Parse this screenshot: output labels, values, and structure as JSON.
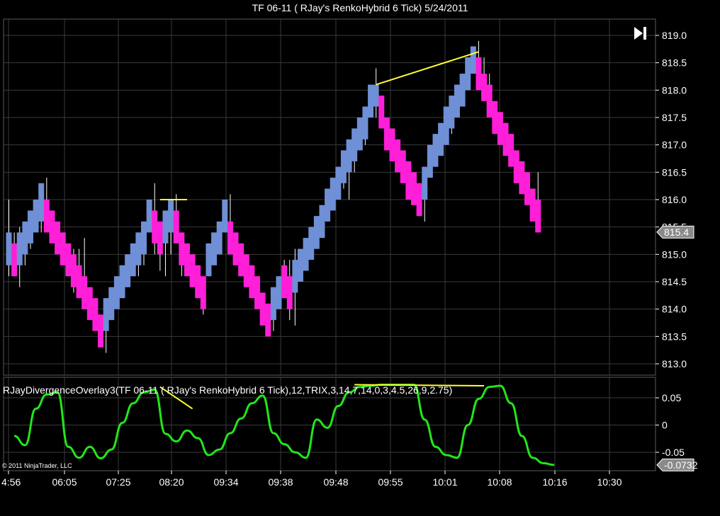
{
  "window": {
    "title": "TF 06-11  ( RJay's RenkoHybrid  6 Tick)  5/24/2011"
  },
  "footer": {
    "copyright": "© 2011 NinjaTrader, LLC"
  },
  "colors": {
    "background": "#000000",
    "grid": "#3a3a3a",
    "up_candle": "#6f8fd6",
    "down_candle": "#ff1fd8",
    "wick": "#ffffff",
    "divergence_line": "#ffff33",
    "indicator_line": "#22e61a",
    "price_badge": "#8a8a8a"
  },
  "icons": {
    "play": "play-to-end-icon"
  },
  "chart_data": [
    {
      "type": "candlestick",
      "name": "price-panel",
      "title": "TF 06-11  ( RJay's RenkoHybrid  6 Tick)  5/24/2011",
      "x_tick_labels": [
        "4:56",
        "06:05",
        "07:25",
        "08:20",
        "09:34",
        "09:38",
        "09:48",
        "09:55",
        "10:01",
        "10:08",
        "10:16",
        "10:30"
      ],
      "y_tick_labels": [
        "813.0",
        "813.5",
        "814.0",
        "814.5",
        "815.0",
        "815.5",
        "816.0",
        "816.5",
        "817.0",
        "817.5",
        "818.0",
        "818.5",
        "819.0"
      ],
      "ylim": [
        812.8,
        819.2
      ],
      "grid": true,
      "last_price_label": "815.4",
      "bricks": [
        {
          "dir": "up",
          "open": 814.8,
          "close": 815.4,
          "high": 816.0,
          "low": 814.6
        },
        {
          "dir": "down",
          "open": 815.2,
          "close": 814.6,
          "high": 815.4,
          "low": 814.6
        },
        {
          "dir": "up",
          "open": 814.8,
          "close": 815.4,
          "high": 815.5,
          "low": 814.4
        },
        {
          "dir": "up",
          "open": 815.0,
          "close": 815.6,
          "high": 815.6,
          "low": 814.8
        },
        {
          "dir": "up",
          "open": 815.2,
          "close": 815.8,
          "high": 815.8,
          "low": 815.1
        },
        {
          "dir": "up",
          "open": 815.4,
          "close": 816.0,
          "high": 816.0,
          "low": 815.4
        },
        {
          "dir": "up",
          "open": 815.6,
          "close": 816.3,
          "high": 816.3,
          "low": 815.4
        },
        {
          "dir": "down",
          "open": 816.0,
          "close": 815.4,
          "high": 816.4,
          "low": 815.4
        },
        {
          "dir": "down",
          "open": 815.8,
          "close": 815.2,
          "high": 815.8,
          "low": 815.2
        },
        {
          "dir": "down",
          "open": 815.6,
          "close": 815.0,
          "high": 815.6,
          "low": 815.0
        },
        {
          "dir": "down",
          "open": 815.4,
          "close": 814.8,
          "high": 815.4,
          "low": 814.8
        },
        {
          "dir": "down",
          "open": 815.2,
          "close": 814.6,
          "high": 815.2,
          "low": 814.6
        },
        {
          "dir": "down",
          "open": 815.0,
          "close": 814.4,
          "high": 815.1,
          "low": 814.3
        },
        {
          "dir": "down",
          "open": 814.8,
          "close": 814.2,
          "high": 815.1,
          "low": 814.2
        },
        {
          "dir": "down",
          "open": 814.6,
          "close": 814.0,
          "high": 815.3,
          "low": 814.0
        },
        {
          "dir": "down",
          "open": 814.4,
          "close": 813.8,
          "high": 814.4,
          "low": 813.8
        },
        {
          "dir": "down",
          "open": 814.2,
          "close": 813.6,
          "high": 814.2,
          "low": 813.6
        },
        {
          "dir": "down",
          "open": 813.9,
          "close": 813.3,
          "high": 813.9,
          "low": 813.3
        },
        {
          "dir": "up",
          "open": 813.6,
          "close": 814.2,
          "high": 814.2,
          "low": 813.2
        },
        {
          "dir": "up",
          "open": 813.8,
          "close": 814.4,
          "high": 814.4,
          "low": 813.8
        },
        {
          "dir": "up",
          "open": 814.0,
          "close": 814.6,
          "high": 814.6,
          "low": 814.0
        },
        {
          "dir": "up",
          "open": 814.2,
          "close": 814.8,
          "high": 814.8,
          "low": 814.2
        },
        {
          "dir": "up",
          "open": 814.4,
          "close": 815.0,
          "high": 815.0,
          "low": 814.4
        },
        {
          "dir": "up",
          "open": 814.6,
          "close": 815.2,
          "high": 815.2,
          "low": 814.6
        },
        {
          "dir": "up",
          "open": 814.8,
          "close": 815.4,
          "high": 815.4,
          "low": 814.6
        },
        {
          "dir": "up",
          "open": 815.0,
          "close": 815.6,
          "high": 815.6,
          "low": 814.8
        },
        {
          "dir": "up",
          "open": 815.4,
          "close": 816.0,
          "high": 816.0,
          "low": 815.4
        },
        {
          "dir": "down",
          "open": 815.8,
          "close": 815.2,
          "high": 816.3,
          "low": 815.0
        },
        {
          "dir": "down",
          "open": 815.6,
          "close": 815.0,
          "high": 815.6,
          "low": 814.7
        },
        {
          "dir": "up",
          "open": 815.2,
          "close": 815.8,
          "high": 815.8,
          "low": 814.6
        },
        {
          "dir": "up",
          "open": 815.4,
          "close": 816.0,
          "high": 816.0,
          "low": 815.0
        },
        {
          "dir": "down",
          "open": 815.8,
          "close": 815.2,
          "high": 816.1,
          "low": 815.2
        },
        {
          "dir": "down",
          "open": 815.4,
          "close": 814.8,
          "high": 815.4,
          "low": 814.6
        },
        {
          "dir": "down",
          "open": 815.2,
          "close": 814.6,
          "high": 815.2,
          "low": 814.6
        },
        {
          "dir": "down",
          "open": 815.0,
          "close": 814.4,
          "high": 815.0,
          "low": 814.4
        },
        {
          "dir": "down",
          "open": 814.8,
          "close": 814.2,
          "high": 814.8,
          "low": 814.2
        },
        {
          "dir": "down",
          "open": 814.6,
          "close": 814.0,
          "high": 814.6,
          "low": 813.9
        },
        {
          "dir": "up",
          "open": 814.6,
          "close": 815.2,
          "high": 815.2,
          "low": 814.6
        },
        {
          "dir": "up",
          "open": 814.8,
          "close": 815.4,
          "high": 815.4,
          "low": 814.8
        },
        {
          "dir": "up",
          "open": 815.0,
          "close": 815.6,
          "high": 815.6,
          "low": 815.0
        },
        {
          "dir": "up",
          "open": 815.4,
          "close": 816.0,
          "high": 816.0,
          "low": 815.4
        },
        {
          "dir": "down",
          "open": 815.6,
          "close": 815.0,
          "high": 816.1,
          "low": 815.0
        },
        {
          "dir": "down",
          "open": 815.4,
          "close": 814.8,
          "high": 815.4,
          "low": 814.8
        },
        {
          "dir": "down",
          "open": 815.2,
          "close": 814.6,
          "high": 815.2,
          "low": 814.6
        },
        {
          "dir": "down",
          "open": 815.0,
          "close": 814.4,
          "high": 815.0,
          "low": 814.4
        },
        {
          "dir": "down",
          "open": 814.8,
          "close": 814.2,
          "high": 814.8,
          "low": 814.2
        },
        {
          "dir": "down",
          "open": 814.6,
          "close": 814.0,
          "high": 814.6,
          "low": 814.0
        },
        {
          "dir": "down",
          "open": 814.3,
          "close": 813.7,
          "high": 814.3,
          "low": 813.7
        },
        {
          "dir": "down",
          "open": 814.1,
          "close": 813.5,
          "high": 814.1,
          "low": 813.5
        },
        {
          "dir": "up",
          "open": 813.8,
          "close": 814.4,
          "high": 814.4,
          "low": 813.6
        },
        {
          "dir": "up",
          "open": 814.0,
          "close": 814.6,
          "high": 814.6,
          "low": 814.0
        },
        {
          "dir": "down",
          "open": 814.8,
          "close": 814.2,
          "high": 814.9,
          "low": 814.2
        },
        {
          "dir": "down",
          "open": 814.6,
          "close": 814.0,
          "high": 814.9,
          "low": 813.8
        },
        {
          "dir": "up",
          "open": 814.3,
          "close": 814.9,
          "high": 815.1,
          "low": 813.7
        },
        {
          "dir": "up",
          "open": 814.5,
          "close": 815.1,
          "high": 815.1,
          "low": 814.5
        },
        {
          "dir": "up",
          "open": 814.7,
          "close": 815.3,
          "high": 815.3,
          "low": 814.7
        },
        {
          "dir": "up",
          "open": 814.9,
          "close": 815.5,
          "high": 815.5,
          "low": 814.9
        },
        {
          "dir": "up",
          "open": 815.1,
          "close": 815.7,
          "high": 815.7,
          "low": 815.1
        },
        {
          "dir": "up",
          "open": 815.3,
          "close": 815.9,
          "high": 815.9,
          "low": 815.3
        },
        {
          "dir": "up",
          "open": 815.6,
          "close": 816.2,
          "high": 816.2,
          "low": 815.6
        },
        {
          "dir": "up",
          "open": 815.8,
          "close": 816.4,
          "high": 816.4,
          "low": 815.8
        },
        {
          "dir": "up",
          "open": 816.0,
          "close": 816.6,
          "high": 816.6,
          "low": 816.0
        },
        {
          "dir": "up",
          "open": 816.3,
          "close": 816.9,
          "high": 816.9,
          "low": 816.2
        },
        {
          "dir": "up",
          "open": 816.5,
          "close": 817.1,
          "high": 817.1,
          "low": 816.0
        },
        {
          "dir": "up",
          "open": 816.7,
          "close": 817.3,
          "high": 817.3,
          "low": 816.5
        },
        {
          "dir": "up",
          "open": 816.9,
          "close": 817.5,
          "high": 817.5,
          "low": 816.9
        },
        {
          "dir": "up",
          "open": 817.1,
          "close": 817.7,
          "high": 817.7,
          "low": 817.0
        },
        {
          "dir": "up",
          "open": 817.5,
          "close": 818.1,
          "high": 818.1,
          "low": 817.5
        },
        {
          "dir": "up",
          "open": 817.7,
          "close": 818.1,
          "high": 818.4,
          "low": 817.5
        },
        {
          "dir": "down",
          "open": 817.9,
          "close": 817.3,
          "high": 817.9,
          "low": 817.3
        },
        {
          "dir": "down",
          "open": 817.5,
          "close": 816.9,
          "high": 817.5,
          "low": 816.9
        },
        {
          "dir": "down",
          "open": 817.3,
          "close": 816.7,
          "high": 817.3,
          "low": 816.7
        },
        {
          "dir": "down",
          "open": 817.1,
          "close": 816.5,
          "high": 817.1,
          "low": 816.5
        },
        {
          "dir": "down",
          "open": 816.9,
          "close": 816.3,
          "high": 816.9,
          "low": 816.3
        },
        {
          "dir": "down",
          "open": 816.7,
          "close": 816.0,
          "high": 816.7,
          "low": 816.0
        },
        {
          "dir": "down",
          "open": 816.5,
          "close": 815.9,
          "high": 816.5,
          "low": 815.9
        },
        {
          "dir": "down",
          "open": 816.3,
          "close": 815.7,
          "high": 816.3,
          "low": 815.7
        },
        {
          "dir": "up",
          "open": 816.0,
          "close": 816.6,
          "high": 816.6,
          "low": 815.6
        },
        {
          "dir": "up",
          "open": 816.4,
          "close": 817.0,
          "high": 817.0,
          "low": 816.4
        },
        {
          "dir": "up",
          "open": 816.6,
          "close": 817.2,
          "high": 817.2,
          "low": 816.6
        },
        {
          "dir": "up",
          "open": 816.8,
          "close": 817.4,
          "high": 817.4,
          "low": 816.8
        },
        {
          "dir": "up",
          "open": 817.0,
          "close": 817.7,
          "high": 817.7,
          "low": 817.0
        },
        {
          "dir": "up",
          "open": 817.3,
          "close": 817.9,
          "high": 817.9,
          "low": 817.2
        },
        {
          "dir": "up",
          "open": 817.5,
          "close": 818.1,
          "high": 818.1,
          "low": 817.5
        },
        {
          "dir": "up",
          "open": 817.7,
          "close": 818.3,
          "high": 818.3,
          "low": 817.7
        },
        {
          "dir": "up",
          "open": 818.0,
          "close": 818.6,
          "high": 818.6,
          "low": 818.0
        },
        {
          "dir": "up",
          "open": 818.3,
          "close": 818.8,
          "high": 818.8,
          "low": 818.3
        },
        {
          "dir": "down",
          "open": 818.6,
          "close": 818.0,
          "high": 818.9,
          "low": 818.0
        },
        {
          "dir": "down",
          "open": 818.3,
          "close": 817.8,
          "high": 818.6,
          "low": 817.8
        },
        {
          "dir": "down",
          "open": 818.1,
          "close": 817.5,
          "high": 818.3,
          "low": 817.5
        },
        {
          "dir": "down",
          "open": 817.8,
          "close": 817.2,
          "high": 817.8,
          "low": 817.2
        },
        {
          "dir": "down",
          "open": 817.6,
          "close": 817.0,
          "high": 817.6,
          "low": 817.0
        },
        {
          "dir": "down",
          "open": 817.4,
          "close": 816.8,
          "high": 817.4,
          "low": 816.8
        },
        {
          "dir": "down",
          "open": 817.2,
          "close": 816.6,
          "high": 817.2,
          "low": 816.6
        },
        {
          "dir": "down",
          "open": 816.9,
          "close": 816.3,
          "high": 816.9,
          "low": 816.3
        },
        {
          "dir": "down",
          "open": 816.7,
          "close": 816.1,
          "high": 816.7,
          "low": 816.1
        },
        {
          "dir": "down",
          "open": 816.5,
          "close": 815.9,
          "high": 816.5,
          "low": 815.9
        },
        {
          "dir": "down",
          "open": 816.2,
          "close": 815.6,
          "high": 816.2,
          "low": 815.6
        },
        {
          "dir": "down",
          "open": 816.0,
          "close": 815.4,
          "high": 816.5,
          "low": 815.4
        }
      ],
      "divergence_lines": [
        {
          "from_index": 28,
          "to_index": 33,
          "y_from": 816.0,
          "y_to": 816.0
        },
        {
          "from_index": 68,
          "to_index": 87,
          "y_from": 818.1,
          "y_to": 818.7
        }
      ]
    },
    {
      "type": "line",
      "name": "indicator-panel",
      "series_label": "RJayDivergenceOverlay3(TF  06-11  (  RJay's  RenkoHybrid    6  Tick),12,TRIX,3,14,7,14,0,3,4.5,26,9,2.75)",
      "y_tick_labels": [
        "0.05",
        "0",
        "-0.05"
      ],
      "ylim": [
        -0.0795,
        0.0855
      ],
      "grid": true,
      "last_value_label": "-0.0732",
      "series": [
        {
          "x_bar": [
            1,
            3,
            5,
            7,
            9,
            11,
            13,
            15,
            17,
            19,
            21,
            23,
            25,
            27,
            29,
            31,
            33,
            35,
            37,
            39,
            41,
            43,
            45,
            47,
            49,
            51,
            53,
            55,
            57,
            59,
            61,
            63,
            65,
            67,
            69,
            71,
            73,
            75,
            77,
            79,
            81,
            83,
            85,
            87,
            89,
            91,
            93,
            95,
            97,
            99,
            101
          ],
          "values": [
            -0.02,
            -0.037,
            0.03,
            0.056,
            0.06,
            -0.04,
            -0.06,
            -0.04,
            -0.061,
            -0.045,
            0.004,
            0.04,
            0.06,
            0.065,
            -0.016,
            -0.03,
            -0.01,
            -0.024,
            -0.055,
            -0.045,
            -0.015,
            0.012,
            0.04,
            0.054,
            -0.015,
            -0.035,
            -0.05,
            -0.06,
            0.01,
            -0.005,
            0.035,
            0.06,
            0.07,
            0.072,
            0.074,
            0.074,
            0.074,
            0.074,
            0.01,
            -0.04,
            -0.055,
            -0.06,
            0.0,
            0.048,
            0.07,
            0.072,
            0.04,
            -0.02,
            -0.06,
            -0.07,
            -0.0732
          ]
        }
      ],
      "divergence_lines": [
        {
          "from_index": 28,
          "to_index": 34,
          "y_from": 0.07,
          "y_to": 0.03
        },
        {
          "from_index": 64,
          "to_index": 88,
          "y_from": 0.074,
          "y_to": 0.072
        }
      ]
    }
  ]
}
